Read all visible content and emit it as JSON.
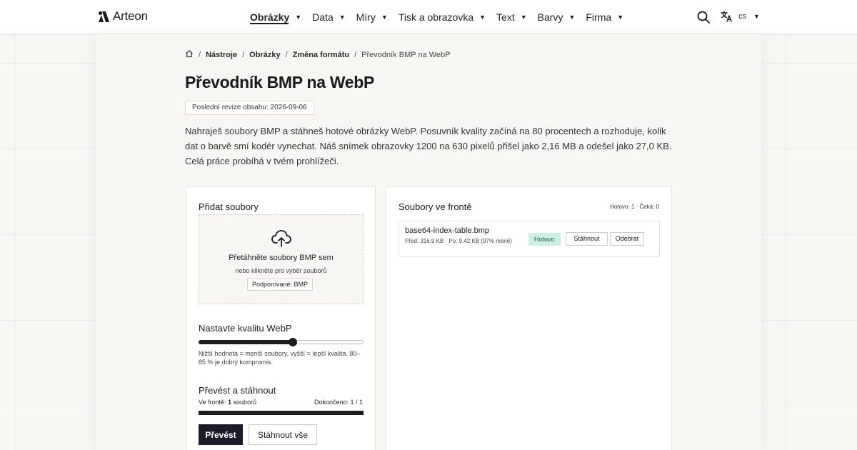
{
  "header": {
    "logo_text": "Arteon",
    "nav": [
      {
        "label": "Obrázky",
        "active": true
      },
      {
        "label": "Data",
        "active": false
      },
      {
        "label": "Míry",
        "active": false
      },
      {
        "label": "Tisk a obrazovka",
        "active": false
      },
      {
        "label": "Text",
        "active": false
      },
      {
        "label": "Barvy",
        "active": false
      },
      {
        "label": "Firma",
        "active": false
      }
    ],
    "caret": "▼",
    "search_icon": "search-icon",
    "language_icon": "translate-icon",
    "language_code": "cs"
  },
  "breadcrumb": {
    "home_icon": "home-icon",
    "separator": "/",
    "items": [
      "Nástroje",
      "Obrázky",
      "Změna formátu"
    ],
    "current": "Převodník BMP na WebP"
  },
  "page": {
    "title": "Převodník BMP na WebP",
    "revision": "Poslední revize obsahu: 2026-09-06",
    "intro": "Nahraješ soubory BMP a stáhneš hotové obrázky WebP. Posuvník kvality začíná na 80 procentech a rozhoduje, kolik dat o barvě smí kodér vynechat. Náš snímek obrazovky 1200 na 630 pixelů přišel jako 2,16 MB a odešel jako 27,0 KB. Celá práce probíhá v tvém prohlížeči."
  },
  "upload": {
    "title": "Přidat soubory",
    "dropzone_icon": "cloud-upload-icon",
    "dropzone_title": "Přetáhněte soubory BMP sem",
    "dropzone_sub": "nebo klikněte pro výběr souborů",
    "supported": "Podporované: BMP"
  },
  "quality": {
    "title": "Nastavte kvalitu WebP",
    "value_percent": 57,
    "hint": "Nižší hodnota = menší soubory, vyšší = lepší kvalita. 80–85 % je dobrý kompromis."
  },
  "convert": {
    "title": "Převést a stáhnout",
    "queue_prefix": "Ve frontě: ",
    "queue_count": "1",
    "queue_suffix": " souborů",
    "done": "Dokončeno: 1 / 1",
    "progress_percent": 100,
    "convert_label": "Převést",
    "download_all_label": "Stáhnout vše"
  },
  "queue": {
    "title": "Soubory ve frontě",
    "stats": "Hotovo: 1 · Čeká: 0",
    "files": [
      {
        "name": "base64-index-table.bmp",
        "meta": "Před: 316.9 KB · Po: 9.42 KB (97% méně)",
        "status": "Hotovo",
        "download_label": "Stáhnout",
        "remove_label": "Odebrat"
      }
    ]
  },
  "colors": {
    "primary": "#1b1b2a",
    "success_bg": "#cdeee0",
    "success_text": "#1d5a44",
    "background": "#f8f6f3"
  }
}
